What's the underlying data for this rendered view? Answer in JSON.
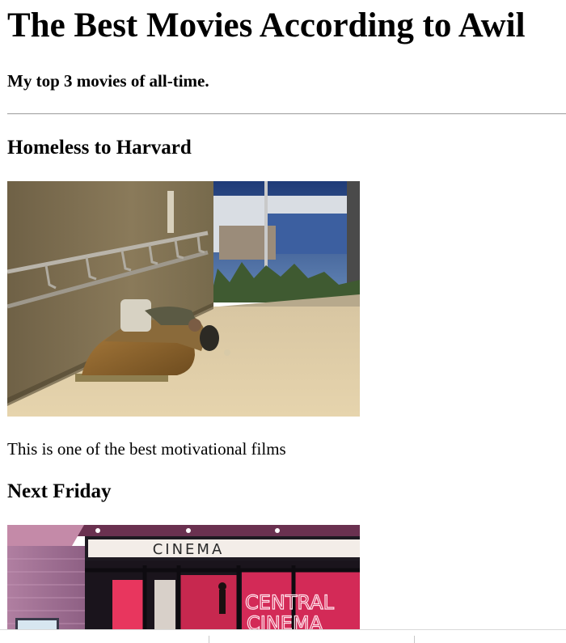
{
  "page": {
    "title": "The Best Movies According to Awil",
    "subtitle": "My top 3 movies of all-time."
  },
  "movies": [
    {
      "title": "Homeless to Harvard",
      "image": "homeless-person-sleeping-photo",
      "description": "This is one of the best motivational films"
    },
    {
      "title": "Next Friday",
      "image": "cinema-storefront-photo",
      "sign_top": "CINEMA",
      "sign_neon_1": "CENTRAL",
      "sign_neon_2": "CINEMA"
    }
  ],
  "colors": {
    "text": "#000000",
    "background": "#ffffff",
    "neon_pink": "#ff3d6e"
  }
}
